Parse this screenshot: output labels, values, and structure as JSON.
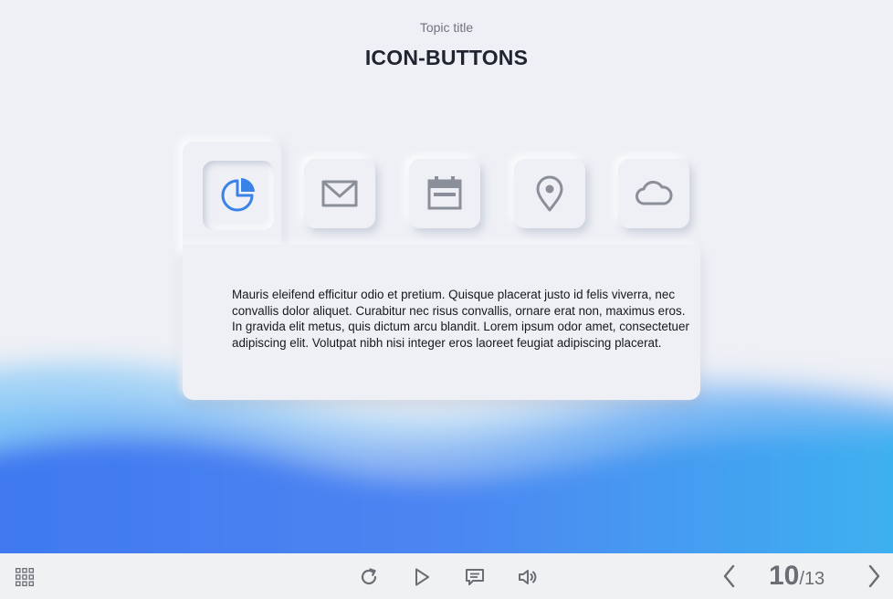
{
  "header": {
    "topic_label": "Topic title",
    "title": "ICON-BUTTONS"
  },
  "icon_buttons": [
    {
      "icon": "pie-chart-icon",
      "active": true
    },
    {
      "icon": "mail-icon",
      "active": false
    },
    {
      "icon": "calendar-icon",
      "active": false
    },
    {
      "icon": "location-pin-icon",
      "active": false
    },
    {
      "icon": "cloud-icon",
      "active": false
    }
  ],
  "panel": {
    "text": "Mauris eleifend efficitur odio et pretium. Quisque placerat justo id felis viverra, nec convallis dolor aliquet. Curabitur nec risus convallis, ornare erat non, maximus eros. In gravida elit metus, quis dictum arcu blandit. Lorem ipsum odor amet, consectetuer adipiscing elit. Volutpat nibh nisi integer eros laoreet feugiat adipiscing placerat."
  },
  "footer": {
    "controls": [
      "menu-grid-icon",
      "replay-icon",
      "play-icon",
      "comment-icon",
      "volume-icon"
    ],
    "page_current": "10",
    "page_sep": "/",
    "page_total": "13"
  },
  "colors": {
    "background": "#eef0f5",
    "accent": "#3b82e8",
    "icon_gray": "#8a8f99",
    "footer_bg": "#f0f1f3",
    "wave_dark": "#4a7ff0",
    "wave_light": "#6cc4f7"
  }
}
